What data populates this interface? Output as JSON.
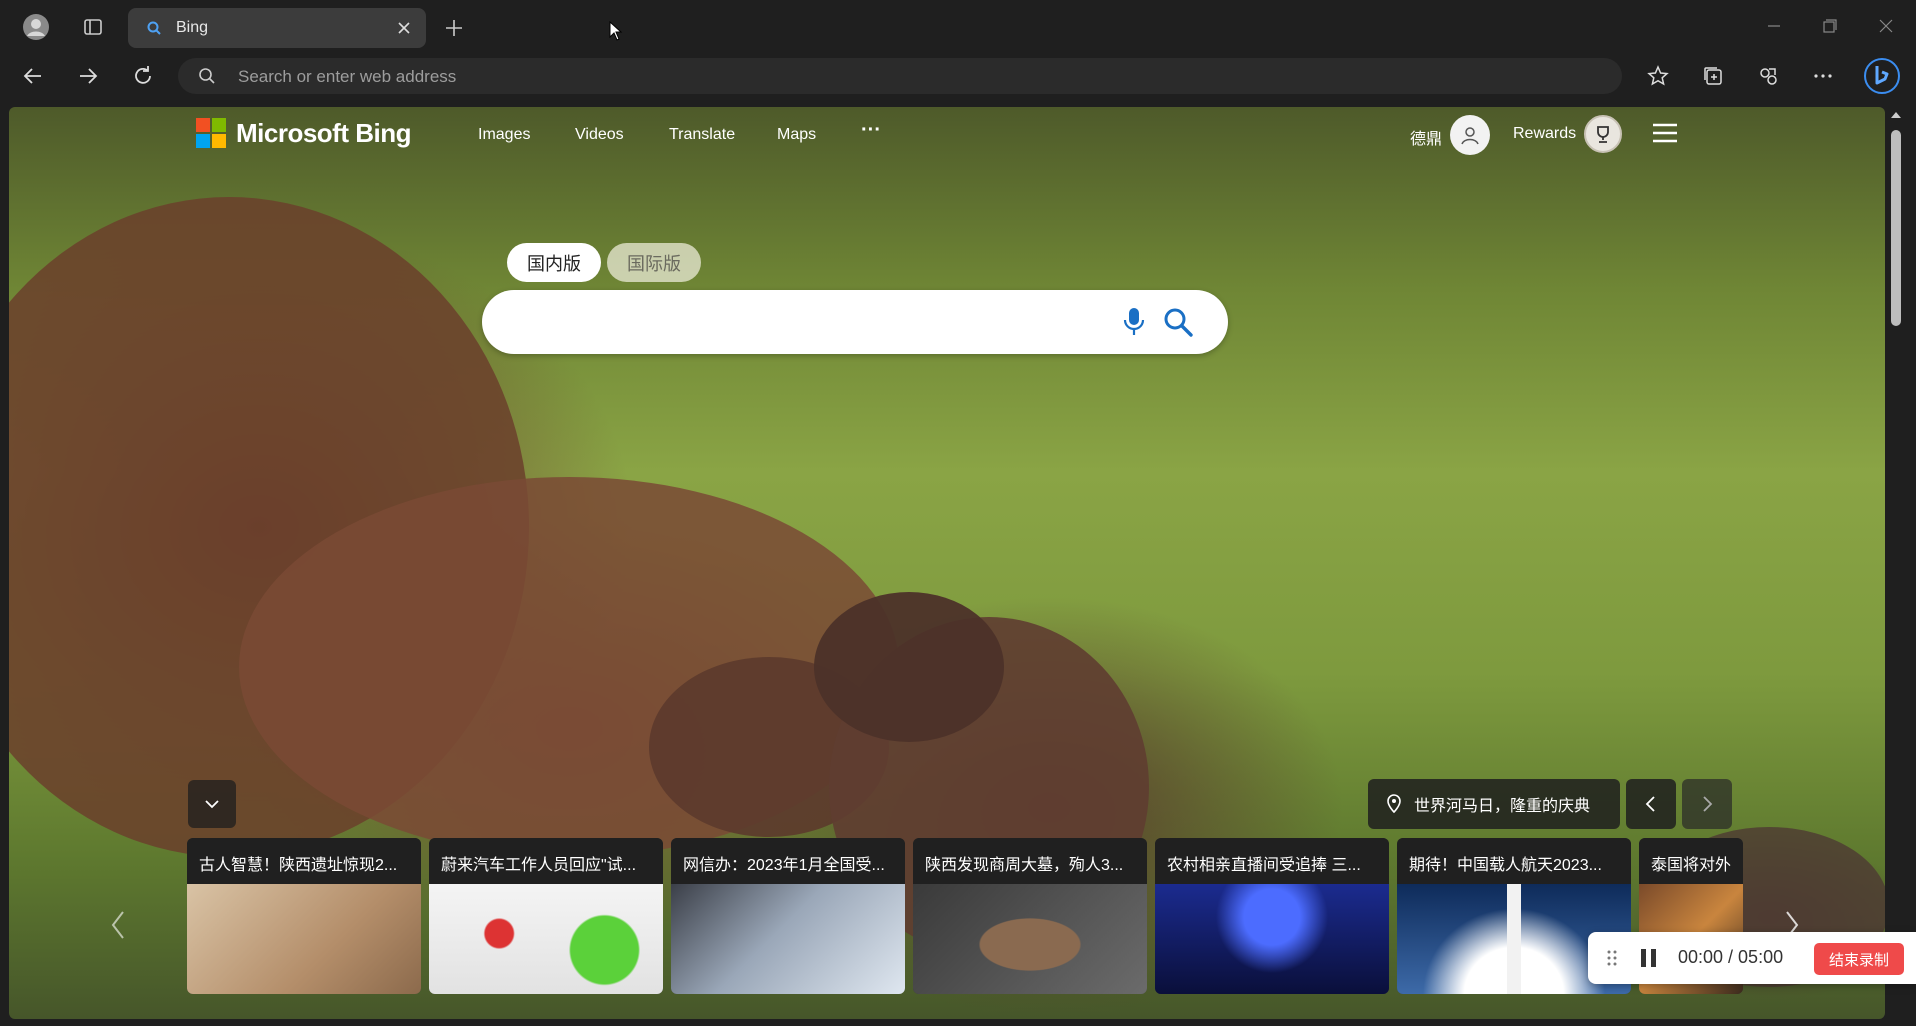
{
  "browser": {
    "tab": {
      "title": "Bing",
      "favicon": "bing-search-icon"
    },
    "address_bar": {
      "placeholder": "Search or enter web address",
      "value": ""
    },
    "colors": {
      "chrome": "#1f1f1f",
      "tab_active": "#3c3c3c",
      "address_bar": "#2b2b2b"
    }
  },
  "bing": {
    "logo_text": "Microsoft Bing",
    "nav": [
      "Images",
      "Videos",
      "Translate",
      "Maps",
      "···"
    ],
    "user_name": "德鼎",
    "rewards_label": "Rewards",
    "scope_tabs": {
      "domestic": "国内版",
      "international": "国际版",
      "selected": "国内版"
    },
    "search": {
      "value": ""
    },
    "image_info": "世界河马日，隆重的庆典",
    "news": [
      {
        "title": "古人智慧！陕西遗址惊现2..."
      },
      {
        "title": "蔚来汽车工作人员回应\"试..."
      },
      {
        "title": "网信办：2023年1月全国受..."
      },
      {
        "title": "陕西发现商周大墓，殉人3..."
      },
      {
        "title": "农村相亲直播间受追捧 三..."
      },
      {
        "title": "期待！中国载人航天2023..."
      },
      {
        "title": "泰国将对外"
      }
    ]
  },
  "recorder": {
    "time_display": "00:00 / 05:00",
    "end_label": "结束录制",
    "colors": {
      "end_button": "#ef4a4a"
    }
  }
}
